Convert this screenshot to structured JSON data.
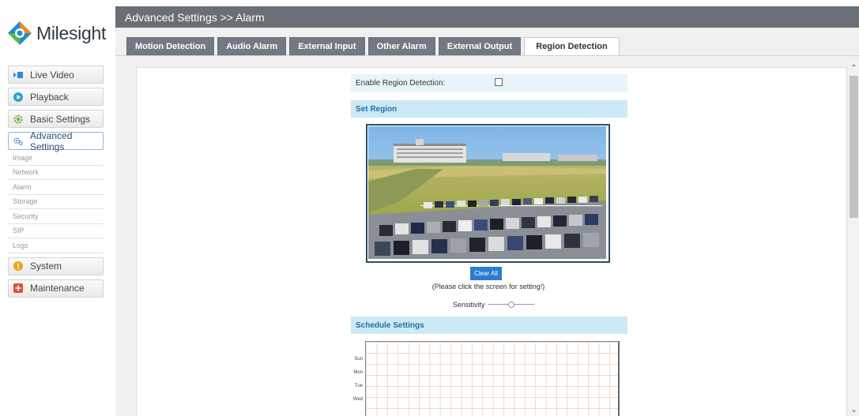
{
  "app": {
    "logo_text": "Milesight",
    "brand_color": "#1e8bd3"
  },
  "sidebar": {
    "items": [
      {
        "label": "Live Video",
        "icon": "live-video-icon",
        "color": "#2a8fd8"
      },
      {
        "label": "Playback",
        "icon": "playback-icon",
        "color": "#2aa3d6"
      },
      {
        "label": "Basic Settings",
        "icon": "gear-icon",
        "color": "#6cb33e"
      },
      {
        "label": "Advanced Settings",
        "icon": "gears-icon",
        "color": "#5b8ec4",
        "active": true
      },
      {
        "label": "System",
        "icon": "info-icon",
        "color": "#f0a020"
      },
      {
        "label": "Maintenance",
        "icon": "plus-icon",
        "color": "#e04b3c"
      }
    ],
    "subitems": [
      "Image",
      "Network",
      "Alarm",
      "Storage",
      "Security",
      "SIP",
      "Logs"
    ]
  },
  "header": {
    "title": "Advanced Settings >> Alarm"
  },
  "tabs": [
    {
      "label": "Motion Detection"
    },
    {
      "label": "Audio Alarm"
    },
    {
      "label": "External Input"
    },
    {
      "label": "Other Alarm"
    },
    {
      "label": "External Output"
    },
    {
      "label": "Region Detection",
      "active": true
    }
  ],
  "region": {
    "enable_label": "Enable Region Detection:",
    "enabled": false,
    "set_region_title": "Set Region",
    "clear_all_label": "Clear All",
    "hint": "(Please click the screen for setting!)",
    "sensitivity_label": "Sensitivity",
    "sensitivity_level": 0.5
  },
  "schedule": {
    "title": "Schedule Settings",
    "days": [
      "Sun",
      "Mon",
      "Tue",
      "Wed"
    ]
  }
}
